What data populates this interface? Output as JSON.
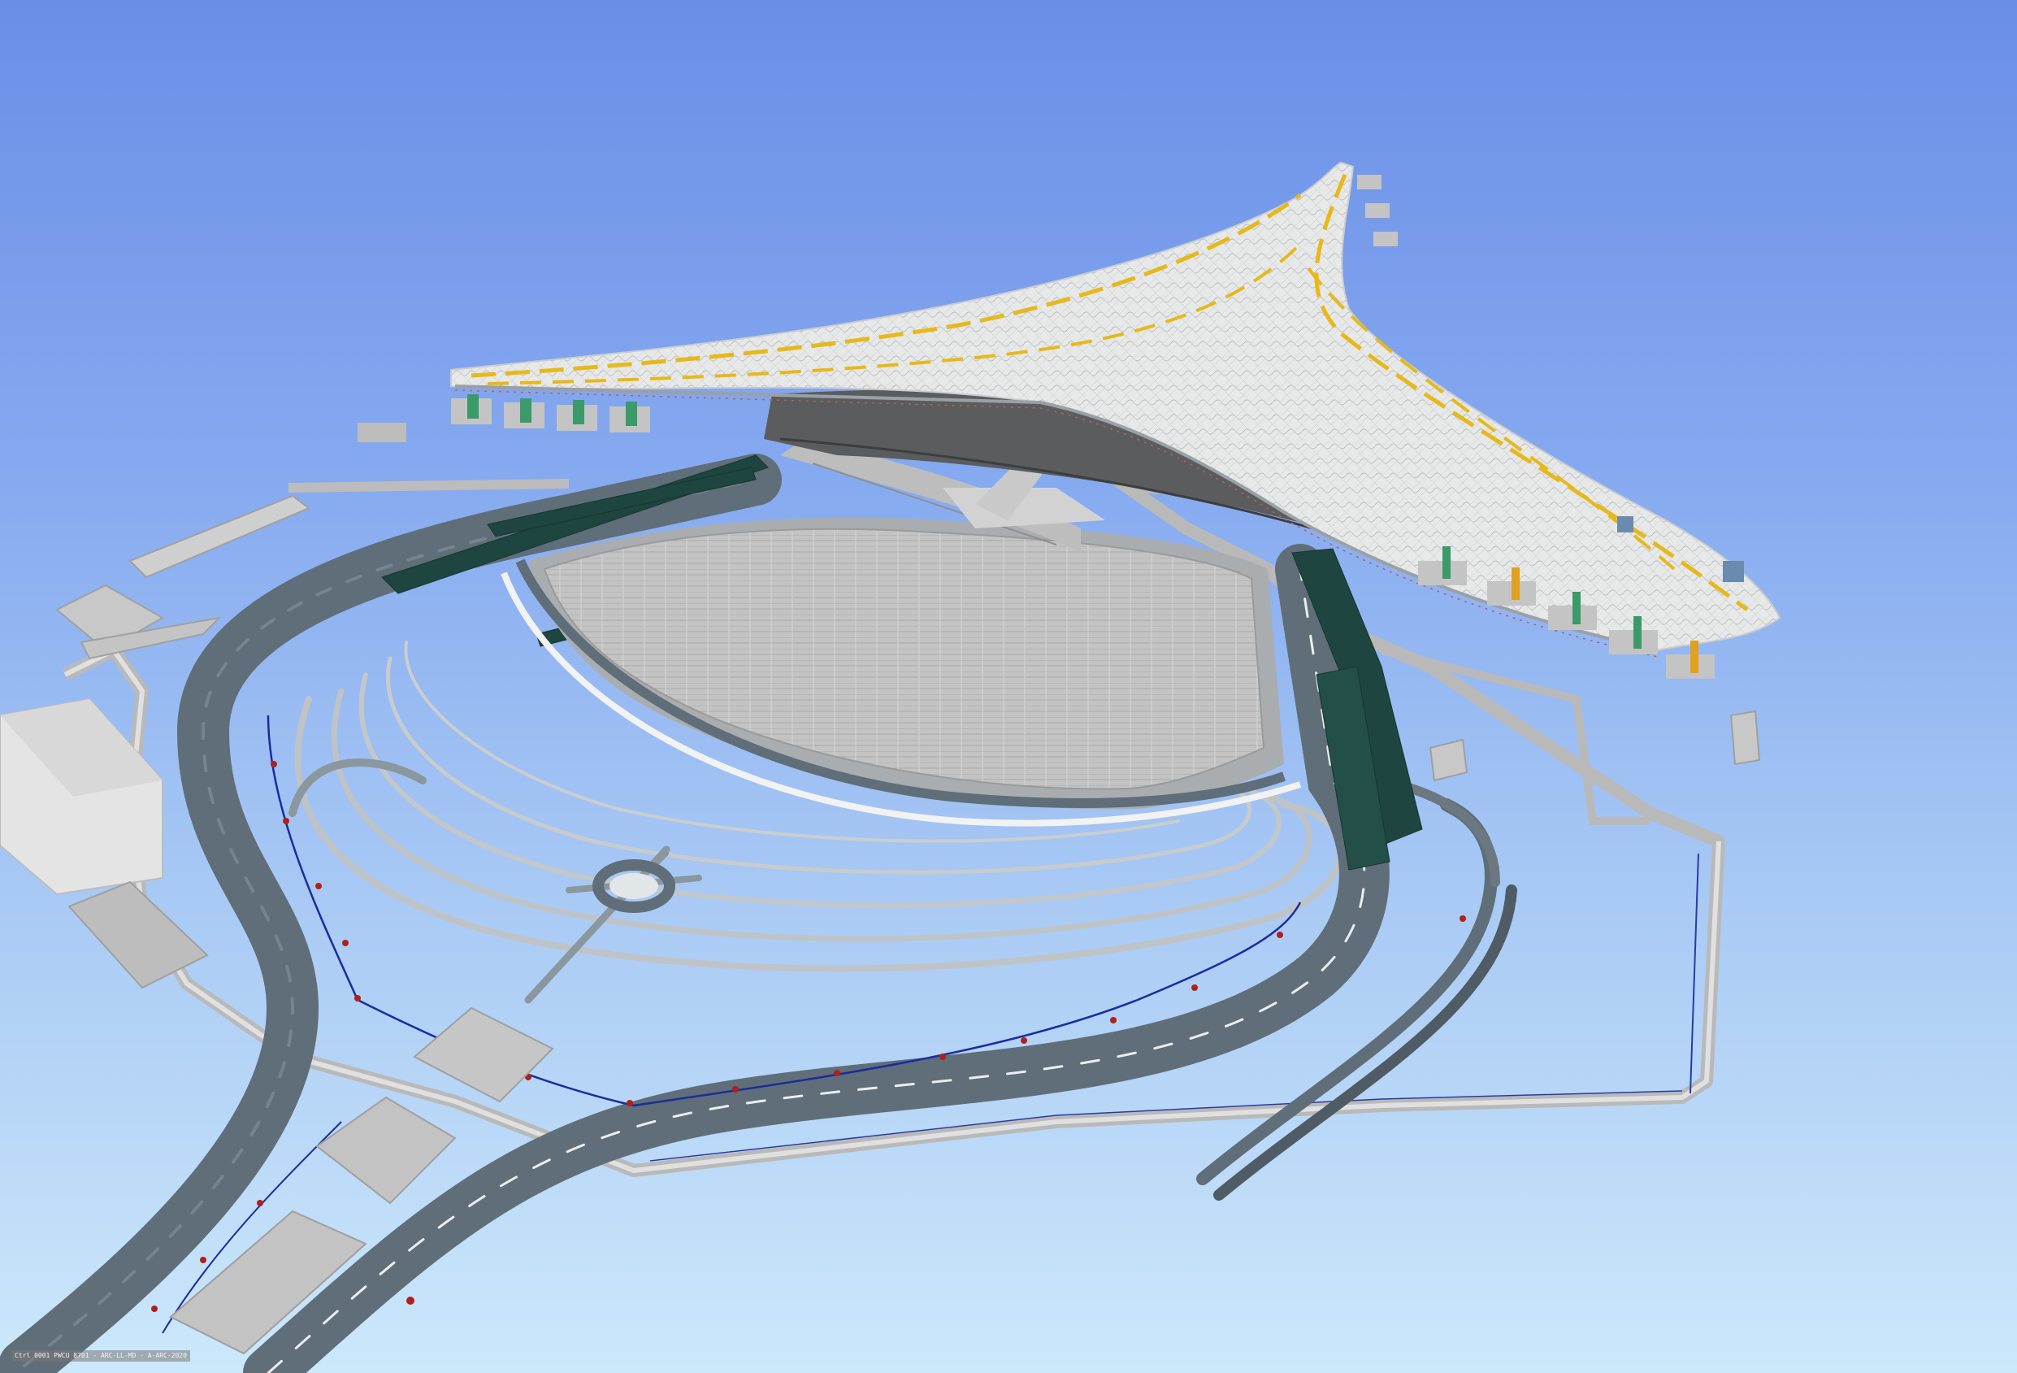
{
  "viewer": {
    "background_top": "#6a8ee6",
    "background_bottom": "#cce8fb"
  },
  "status_bar": {
    "text": "Ctrl 0001 PWCU 8701 - ARC-LL-MD - A-ARC-2020"
  },
  "model": {
    "roof_color": "#e6e7e7",
    "roof_accent_color": "#e6b81a",
    "road_color": "#5f6e78",
    "bridge_color": "#1e4540",
    "building_color": "#c8c8c8",
    "utility_line_color": "#1a2c9c",
    "marker_color": "#b0201a"
  }
}
